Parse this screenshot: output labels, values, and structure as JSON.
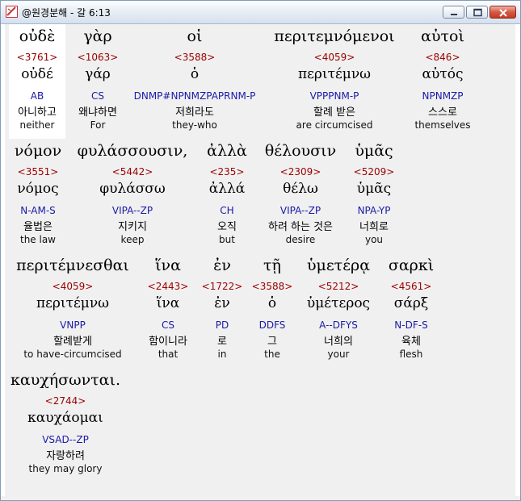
{
  "window": {
    "title": "@원경분해 - 갈 6:13",
    "controls": {
      "minimize": "minimize",
      "maximize": "maximize",
      "close": "close"
    }
  },
  "rows": [
    {
      "words": [
        {
          "greek": "οὐδὲ",
          "strong": "<3761>",
          "lemma": "οὐδέ",
          "parse": "AB",
          "korean": "아니하고",
          "english": "neither"
        },
        {
          "greek": "γὰρ",
          "strong": "<1063>",
          "lemma": "γάρ",
          "parse": "CS",
          "korean": "왜냐하면",
          "english": "For"
        },
        {
          "greek": "οἱ",
          "strong": "<3588>",
          "lemma": "ὁ",
          "parse": "DNMP#NPNMZPAPRNM-P",
          "korean": "저희라도",
          "english": "they-who"
        },
        {
          "greek": "περιτεμνόμενοι",
          "strong": "<4059>",
          "lemma": "περιτέμνω",
          "parse": "VPPPNM-P",
          "korean": "할례 받은",
          "english": "are circumcised"
        },
        {
          "greek": "αὐτοὶ",
          "strong": "<846>",
          "lemma": "αὐτός",
          "parse": "NPNMZP",
          "korean": "스스로",
          "english": "themselves"
        }
      ]
    },
    {
      "words": [
        {
          "greek": "νόμον",
          "strong": "<3551>",
          "lemma": "νόμος",
          "parse": "N-AM-S",
          "korean": "율법은",
          "english": "the law"
        },
        {
          "greek": "φυλάσσουσιν,",
          "strong": "<5442>",
          "lemma": "φυλάσσω",
          "parse": "VIPA--ZP",
          "korean": "지키지",
          "english": "keep"
        },
        {
          "greek": "ἀλλὰ",
          "strong": "<235>",
          "lemma": "ἀλλά",
          "parse": "CH",
          "korean": "오직",
          "english": "but"
        },
        {
          "greek": "θέλουσιν",
          "strong": "<2309>",
          "lemma": "θέλω",
          "parse": "VIPA--ZP",
          "korean": "하려 하는 것은",
          "english": "desire"
        },
        {
          "greek": "ὑμᾶς",
          "strong": "<5209>",
          "lemma": "ὑμᾶς",
          "parse": "NPA-YP",
          "korean": "너희로",
          "english": "you"
        }
      ]
    },
    {
      "words": [
        {
          "greek": "περιτέμνεσθαι",
          "strong": "<4059>",
          "lemma": "περιτέμνω",
          "parse": "VNPP",
          "korean": "할례받게",
          "english": "to have-circumcised"
        },
        {
          "greek": "ἵνα",
          "strong": "<2443>",
          "lemma": "ἵνα",
          "parse": "CS",
          "korean": "함이니라",
          "english": "that"
        },
        {
          "greek": "ἐν",
          "strong": "<1722>",
          "lemma": "ἐν",
          "parse": "PD",
          "korean": "로",
          "english": "in"
        },
        {
          "greek": "τῇ",
          "strong": "<3588>",
          "lemma": "ὁ",
          "parse": "DDFS",
          "korean": "그",
          "english": "the"
        },
        {
          "greek": "ὑμετέρᾳ",
          "strong": "<5212>",
          "lemma": "ὑμέτερος",
          "parse": "A--DFYS",
          "korean": "너희의",
          "english": "your"
        },
        {
          "greek": "σαρκὶ",
          "strong": "<4561>",
          "lemma": "σάρξ",
          "parse": "N-DF-S",
          "korean": "육체",
          "english": "flesh"
        }
      ]
    },
    {
      "words": [
        {
          "greek": "καυχήσωνται.",
          "strong": "<2744>",
          "lemma": "καυχάομαι",
          "parse": "VSAD--ZP",
          "korean": "자랑하려",
          "english": "they may glory"
        }
      ]
    }
  ]
}
